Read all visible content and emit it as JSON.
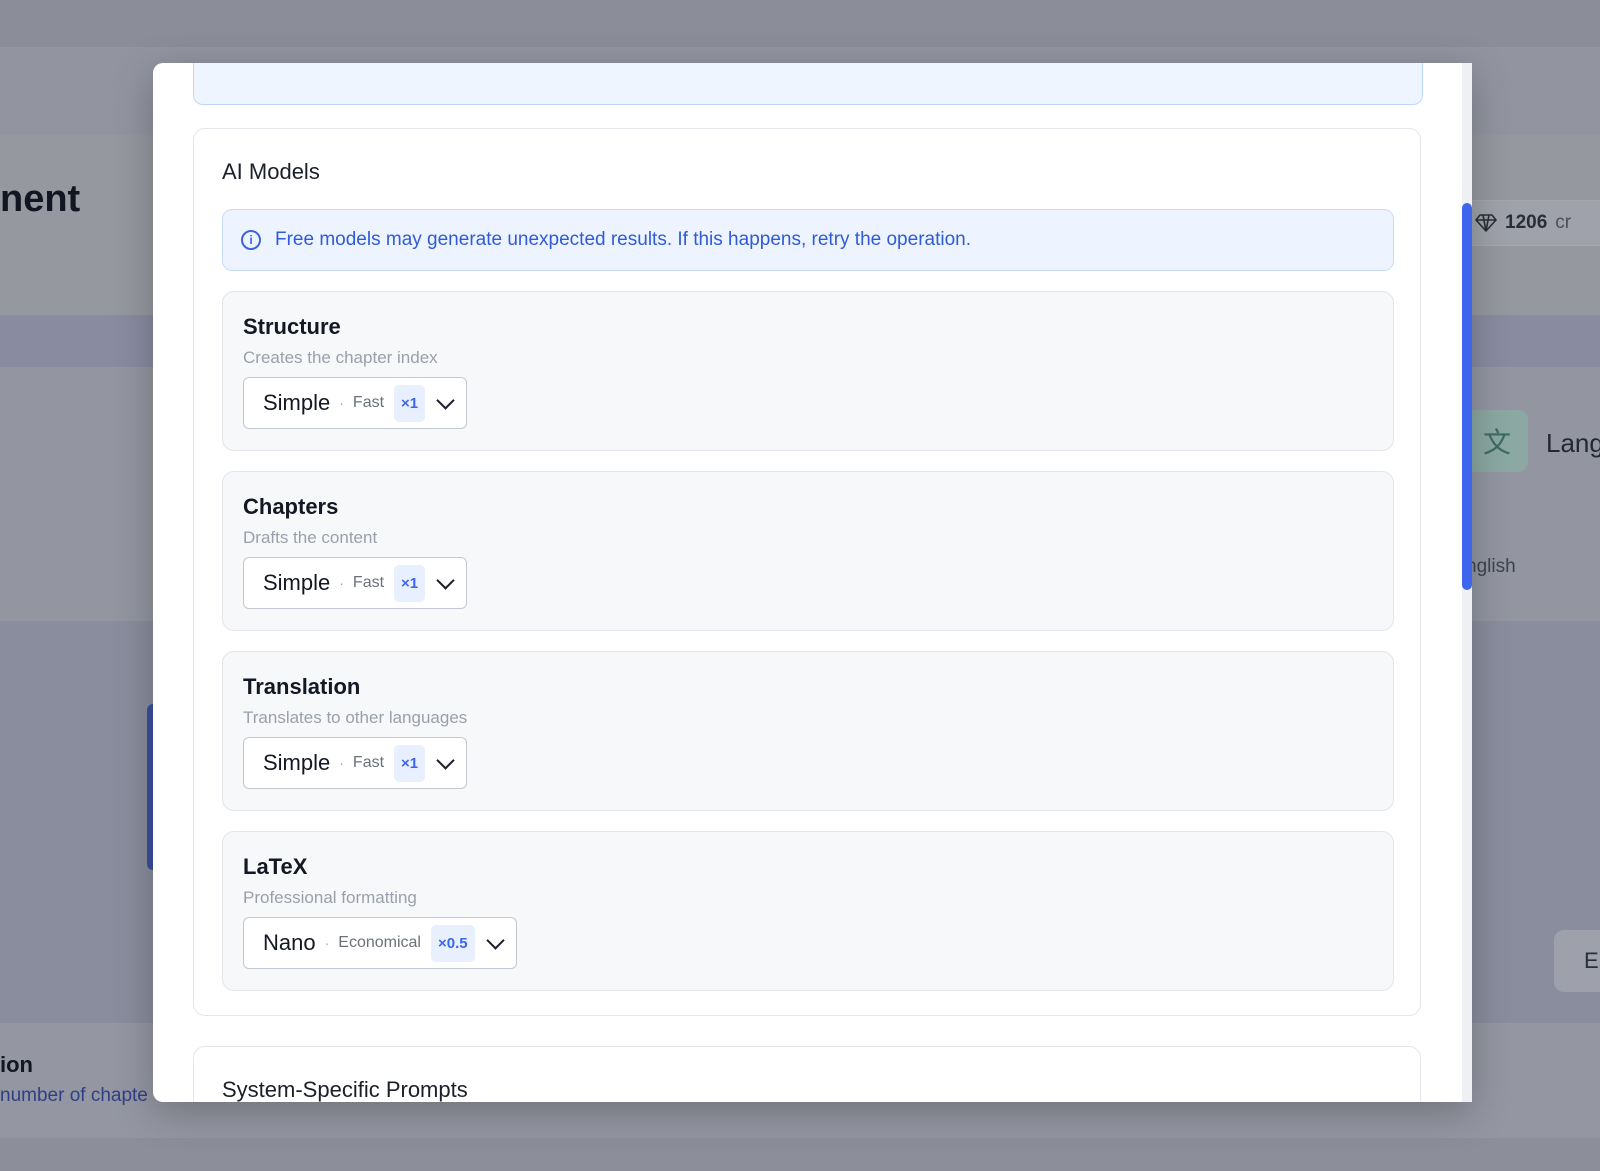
{
  "background": {
    "title_fragment": "nent",
    "credits": {
      "value": "1206",
      "unit": "cr"
    },
    "language_label": "Lang",
    "language_value": "nglish",
    "button_fragment": "E",
    "section_fragment": "ion",
    "chapters_fragment": "number of chapte"
  },
  "modal": {
    "models_section": {
      "title": "AI Models",
      "info": "Free models may generate unexpected results. If this happens, retry the operation.",
      "cards": [
        {
          "title": "Structure",
          "desc": "Creates the chapter index",
          "model": "Simple",
          "tag": "Fast",
          "mult": "×1"
        },
        {
          "title": "Chapters",
          "desc": "Drafts the content",
          "model": "Simple",
          "tag": "Fast",
          "mult": "×1"
        },
        {
          "title": "Translation",
          "desc": "Translates to other languages",
          "model": "Simple",
          "tag": "Fast",
          "mult": "×1"
        },
        {
          "title": "LaTeX",
          "desc": "Professional formatting",
          "model": "Nano",
          "tag": "Economical",
          "mult": "×0.5"
        }
      ]
    },
    "prompts_section": {
      "title": "System-Specific Prompts"
    },
    "separator": "·"
  },
  "colors": {
    "accent": "#3e66ec",
    "info_bg": "#eef4ff",
    "card_bg": "#f7f8fa"
  },
  "icons": {
    "info": "info-circle-icon",
    "dropdown": "chevron-down-icon",
    "credits": "diamond-icon",
    "language": "translate-icon"
  }
}
